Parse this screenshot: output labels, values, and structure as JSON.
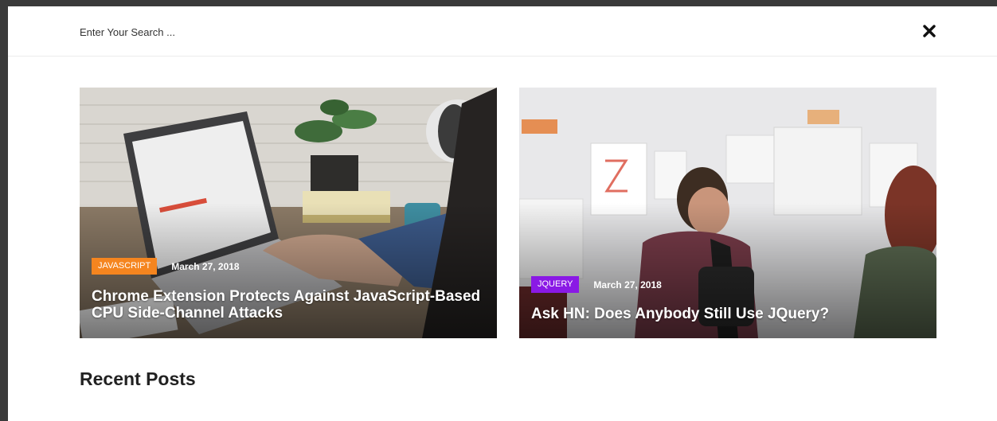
{
  "search": {
    "placeholder": "Enter Your Search ..."
  },
  "close": {
    "icon": "close-icon"
  },
  "featured_posts": [
    {
      "category": "JAVASCRIPT",
      "category_color": "#f5851f",
      "date": "March 27, 2018",
      "title": "Chrome Extension Protects Against JavaScript-Based CPU Side-Channel Attacks"
    },
    {
      "category": "JQUERY",
      "category_color": "#8a19e5",
      "date": "March 27, 2018",
      "title": "Ask HN: Does Anybody Still Use JQuery?"
    }
  ],
  "recent_posts": {
    "heading": "Recent Posts"
  }
}
